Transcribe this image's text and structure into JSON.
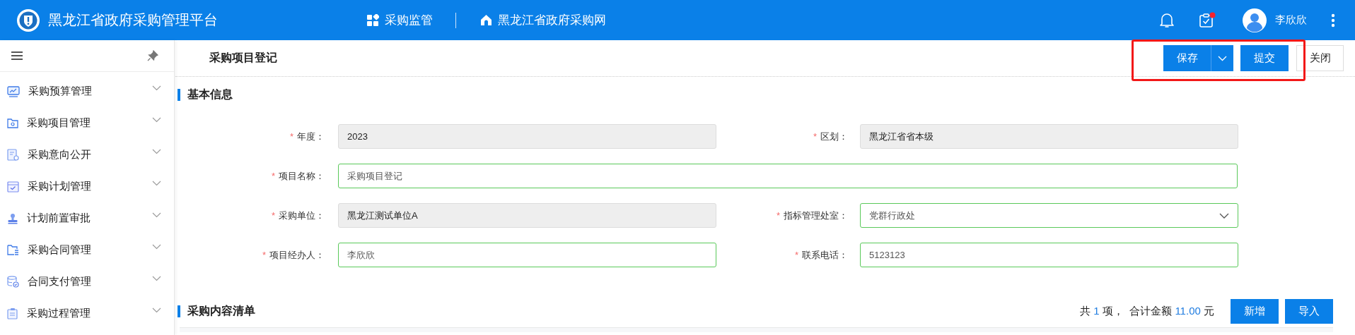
{
  "header": {
    "title": "黑龙江省政府采购管理平台",
    "nav": [
      {
        "label": "采购监管",
        "kind": "apps"
      },
      {
        "label": "黑龙江省政府采购网",
        "kind": "home"
      }
    ],
    "tasks_badge": true,
    "user": {
      "name": "李欣欣"
    }
  },
  "sidebar": {
    "items": [
      {
        "label": "采购预算管理",
        "expanded": false
      },
      {
        "label": "采购项目管理",
        "expanded": false
      },
      {
        "label": "采购意向公开",
        "expanded": false
      },
      {
        "label": "采购计划管理",
        "expanded": false
      },
      {
        "label": "计划前置审批",
        "expanded": false
      },
      {
        "label": "采购合同管理",
        "expanded": false
      },
      {
        "label": "合同支付管理",
        "expanded": false
      },
      {
        "label": "采购过程管理",
        "expanded": false
      }
    ]
  },
  "toolbar": {
    "title": "采购项目登记",
    "highlighted": true,
    "buttons": [
      {
        "label": "保存",
        "kind": "split"
      },
      {
        "label": "提交",
        "kind": "primary"
      },
      {
        "label": "关闭",
        "kind": "plain"
      }
    ]
  },
  "basic_info": {
    "title": "基本信息",
    "rows": [
      [
        {
          "required_mark": "*",
          "label": "年度：",
          "value": "2023",
          "kind": "text",
          "disabled": true
        },
        {
          "required_mark": "*",
          "label": "区划：",
          "value": "黑龙江省省本级",
          "kind": "text",
          "disabled": true
        }
      ],
      [
        {
          "required_mark": "*",
          "label": "项目名称：",
          "value": "采购项目登记",
          "kind": "text",
          "disabled": false
        }
      ],
      [
        {
          "required_mark": "*",
          "label": "采购单位：",
          "value": "黑龙江测试单位A",
          "kind": "text",
          "disabled": true
        },
        {
          "required_mark": "*",
          "label": "指标管理处室：",
          "value": "党群行政处",
          "kind": "select",
          "disabled": false
        }
      ],
      [
        {
          "required_mark": "*",
          "label": "项目经办人：",
          "value": "李欣欣",
          "kind": "text",
          "disabled": false
        },
        {
          "required_mark": "*",
          "label": "联系电话：",
          "value": "5123123",
          "kind": "text",
          "disabled": false
        }
      ]
    ]
  },
  "content_list": {
    "title": "采购内容清单",
    "summary": {
      "prefix": "共",
      "count": "1",
      "unit": "项，",
      "amount_label": "合计金额",
      "amount": "11.00",
      "currency": "元"
    },
    "buttons": [
      "新增",
      "导入"
    ]
  }
}
